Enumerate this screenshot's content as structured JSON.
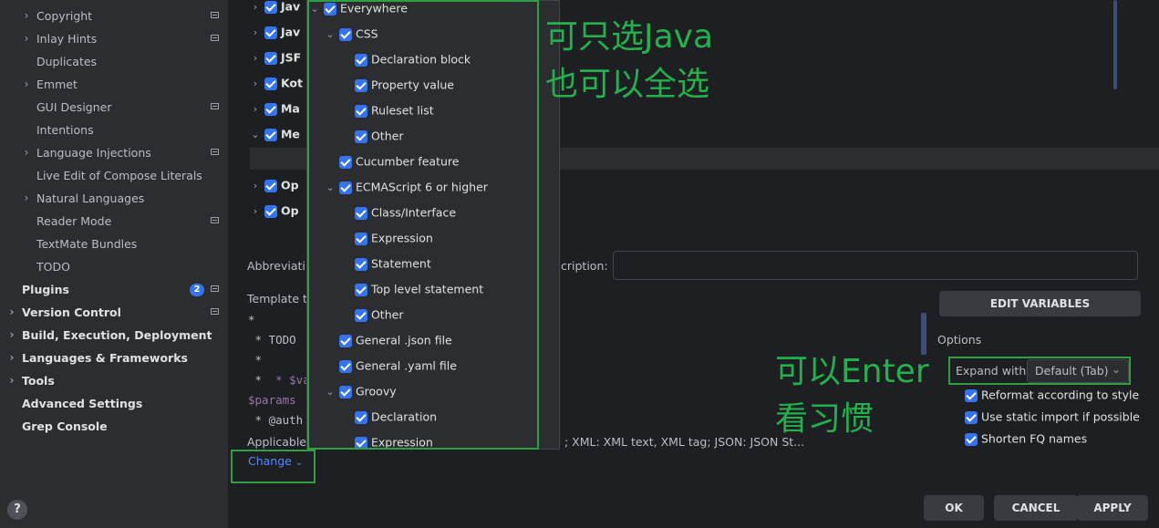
{
  "sidebar": {
    "items": [
      {
        "label": "Copyright",
        "arrow": true,
        "pin": true
      },
      {
        "label": "Inlay Hints",
        "arrow": true,
        "pin": true
      },
      {
        "label": "Duplicates",
        "arrow": false,
        "pin": false
      },
      {
        "label": "Emmet",
        "arrow": true,
        "pin": false
      },
      {
        "label": "GUI Designer",
        "arrow": false,
        "pin": true
      },
      {
        "label": "Intentions",
        "arrow": false,
        "pin": false
      },
      {
        "label": "Language Injections",
        "arrow": true,
        "pin": true
      },
      {
        "label": "Live Edit of Compose Literals",
        "arrow": false,
        "pin": false
      },
      {
        "label": "Natural Languages",
        "arrow": true,
        "pin": false
      },
      {
        "label": "Reader Mode",
        "arrow": false,
        "pin": true
      },
      {
        "label": "TextMate Bundles",
        "arrow": false,
        "pin": false
      },
      {
        "label": "TODO",
        "arrow": false,
        "pin": false
      }
    ],
    "top_items": [
      {
        "label": "Plugins",
        "arrow": false,
        "badge": "2",
        "pin": true
      },
      {
        "label": "Version Control",
        "arrow": true,
        "pin": true
      },
      {
        "label": "Build, Execution, Deployment",
        "arrow": true,
        "pin": false
      },
      {
        "label": "Languages & Frameworks",
        "arrow": true,
        "pin": false
      },
      {
        "label": "Tools",
        "arrow": true,
        "pin": false
      },
      {
        "label": "Advanced Settings",
        "arrow": false,
        "pin": false
      },
      {
        "label": "Grep Console",
        "arrow": false,
        "pin": false
      }
    ],
    "help_label": "?"
  },
  "template_groups": [
    {
      "label": "Jav",
      "expanded": false
    },
    {
      "label": "Jav",
      "expanded": false
    },
    {
      "label": "JSF",
      "expanded": false
    },
    {
      "label": "Kot",
      "expanded": false
    },
    {
      "label": "Ma",
      "expanded": false
    },
    {
      "label": "Me",
      "expanded": true
    },
    {
      "label": "",
      "expanded": null
    },
    {
      "label": "Op",
      "expanded": false
    },
    {
      "label": "Op",
      "expanded": false
    }
  ],
  "form": {
    "abbreviation_label": "Abbreviati",
    "description_label": "cription:",
    "template_text_label": "Template t",
    "edit_variables": "EDIT VARIABLES",
    "code_lines": [
      "*",
      " * TODO",
      " *",
      " * $vari",
      "$params",
      " * @auth"
    ],
    "applicable_label": "Applicable",
    "applicable_value": "; XML: XML text, XML tag; JSON: JSON St...",
    "change_link": "Change",
    "options_title": "Options",
    "expand_with_label": "Expand with",
    "expand_with_value": "Default (Tab)",
    "option_checks": [
      "Reformat according to style",
      "Use static import if possible",
      "Shorten FQ names"
    ]
  },
  "popup": {
    "rows": [
      {
        "label": "Everywhere",
        "level": 0,
        "chevron": "open"
      },
      {
        "label": "CSS",
        "level": 1,
        "chevron": "open"
      },
      {
        "label": "Declaration block",
        "level": 2,
        "chevron": null
      },
      {
        "label": "Property value",
        "level": 2,
        "chevron": null
      },
      {
        "label": "Ruleset list",
        "level": 2,
        "chevron": null
      },
      {
        "label": "Other",
        "level": 2,
        "chevron": null
      },
      {
        "label": "Cucumber feature",
        "level": 1,
        "chevron": null
      },
      {
        "label": "ECMAScript 6 or higher",
        "level": 1,
        "chevron": "open"
      },
      {
        "label": "Class/Interface",
        "level": 2,
        "chevron": null
      },
      {
        "label": "Expression",
        "level": 2,
        "chevron": null
      },
      {
        "label": "Statement",
        "level": 2,
        "chevron": null
      },
      {
        "label": "Top level statement",
        "level": 2,
        "chevron": null
      },
      {
        "label": "Other",
        "level": 2,
        "chevron": null
      },
      {
        "label": "General .json file",
        "level": 1,
        "chevron": null
      },
      {
        "label": "General .yaml file",
        "level": 1,
        "chevron": null
      },
      {
        "label": "Groovy",
        "level": 1,
        "chevron": "open"
      },
      {
        "label": "Declaration",
        "level": 2,
        "chevron": null
      },
      {
        "label": "Expression",
        "level": 2,
        "chevron": null
      }
    ]
  },
  "annotations": {
    "top_line1": "可只选Java",
    "top_line2": "也可以全选",
    "bottom_line1": "可以Enter",
    "bottom_line2": "看习惯",
    "color": "#22b14c"
  },
  "footer": {
    "ok": "OK",
    "cancel": "CANCEL",
    "apply": "APPLY"
  },
  "colors": {
    "accent": "#3574f0",
    "sidebar_bg": "#2b2d30",
    "main_bg": "#1e1f22",
    "annotation": "#2ea043"
  }
}
